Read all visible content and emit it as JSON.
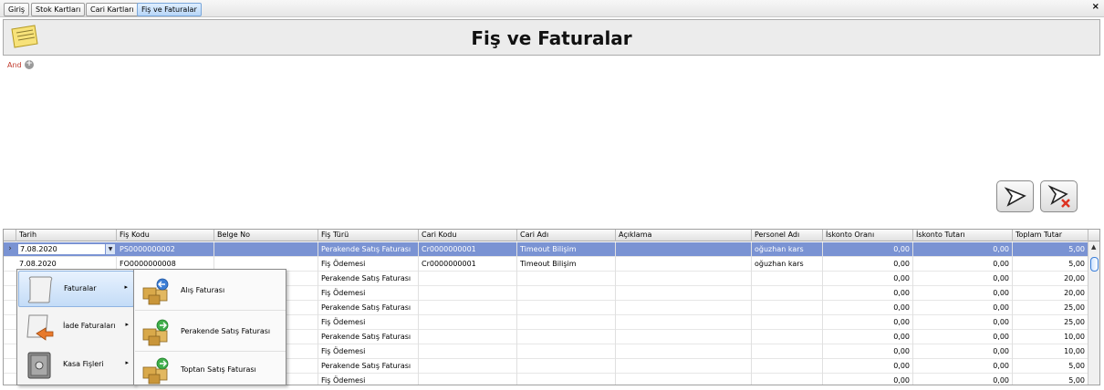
{
  "tabs": [
    {
      "label": "Giriş",
      "active": false
    },
    {
      "label": "Stok Kartları",
      "active": false
    },
    {
      "label": "Cari Kartları",
      "active": false
    },
    {
      "label": "Fiş ve Faturalar",
      "active": true
    }
  ],
  "close_icon": "×",
  "header": {
    "title": "Fiş ve Faturalar",
    "icon": "notepad-icon"
  },
  "filter": {
    "and_label": "And",
    "add_icon": "+",
    "apply_icon": "filter-apply-icon",
    "clear_icon": "filter-clear-icon"
  },
  "grid": {
    "columns": [
      "Tarih",
      "Fiş Kodu",
      "Belge No",
      "Fiş Türü",
      "Cari Kodu",
      "Cari Adı",
      "Açıklama",
      "Personel Adı",
      "İskonto Oranı",
      "İskonto Tutarı",
      "Toplam Tutar"
    ],
    "rows": [
      {
        "tarih": "7.08.2020",
        "fis_kodu": "PS0000000002",
        "belge_no": "",
        "fis_turu": "Perakende Satış Faturası",
        "cari_kodu": "Cr0000000001",
        "cari_adi": "Timeout Bilişim",
        "aciklama": "",
        "personel": "oğuzhan kars",
        "isk_oran": "0,00",
        "isk_tutar": "0,00",
        "toplam": "5,00"
      },
      {
        "tarih": "7.08.2020",
        "fis_kodu": "FO0000000008",
        "belge_no": "",
        "fis_turu": "Fiş Ödemesi",
        "cari_kodu": "Cr0000000001",
        "cari_adi": "Timeout Bilişim",
        "aciklama": "",
        "personel": "oğuzhan kars",
        "isk_oran": "0,00",
        "isk_tutar": "0,00",
        "toplam": "5,00"
      },
      {
        "tarih": "",
        "fis_kodu": "",
        "belge_no": "",
        "fis_turu": "Perakende Satış Faturası",
        "cari_kodu": "",
        "cari_adi": "",
        "aciklama": "",
        "personel": "",
        "isk_oran": "0,00",
        "isk_tutar": "0,00",
        "toplam": "20,00"
      },
      {
        "tarih": "",
        "fis_kodu": "",
        "belge_no": "",
        "fis_turu": "Fiş Ödemesi",
        "cari_kodu": "",
        "cari_adi": "",
        "aciklama": "",
        "personel": "",
        "isk_oran": "0,00",
        "isk_tutar": "0,00",
        "toplam": "20,00"
      },
      {
        "tarih": "",
        "fis_kodu": "",
        "belge_no": "",
        "fis_turu": "Perakende Satış Faturası",
        "cari_kodu": "",
        "cari_adi": "",
        "aciklama": "",
        "personel": "",
        "isk_oran": "0,00",
        "isk_tutar": "0,00",
        "toplam": "25,00"
      },
      {
        "tarih": "",
        "fis_kodu": "",
        "belge_no": "",
        "fis_turu": "Fiş Ödemesi",
        "cari_kodu": "",
        "cari_adi": "",
        "aciklama": "",
        "personel": "",
        "isk_oran": "0,00",
        "isk_tutar": "0,00",
        "toplam": "25,00"
      },
      {
        "tarih": "",
        "fis_kodu": "",
        "belge_no": "",
        "fis_turu": "Perakende Satış Faturası",
        "cari_kodu": "",
        "cari_adi": "",
        "aciklama": "",
        "personel": "",
        "isk_oran": "0,00",
        "isk_tutar": "0,00",
        "toplam": "10,00"
      },
      {
        "tarih": "",
        "fis_kodu": "",
        "belge_no": "",
        "fis_turu": "Fiş Ödemesi",
        "cari_kodu": "",
        "cari_adi": "",
        "aciklama": "",
        "personel": "",
        "isk_oran": "0,00",
        "isk_tutar": "0,00",
        "toplam": "10,00"
      },
      {
        "tarih": "",
        "fis_kodu": "",
        "belge_no": "",
        "fis_turu": "Perakende Satış Faturası",
        "cari_kodu": "",
        "cari_adi": "",
        "aciklama": "",
        "personel": "",
        "isk_oran": "0,00",
        "isk_tutar": "0,00",
        "toplam": "5,00"
      },
      {
        "tarih": "",
        "fis_kodu": "",
        "belge_no": "",
        "fis_turu": "Fiş Ödemesi",
        "cari_kodu": "",
        "cari_adi": "",
        "aciklama": "",
        "personel": "",
        "isk_oran": "0,00",
        "isk_tutar": "0,00",
        "toplam": "5,00"
      }
    ],
    "row_indicator": "›",
    "dropdown_icon": "▼"
  },
  "context_menu": {
    "items": [
      {
        "label": "Faturalar",
        "icon": "scroll-icon",
        "arrow": "▸"
      },
      {
        "label": "İade Faturaları",
        "icon": "return-scroll-icon",
        "arrow": "▸"
      },
      {
        "label": "Kasa Fişleri",
        "icon": "safe-icon",
        "arrow": "▸"
      }
    ]
  },
  "submenu": {
    "items": [
      {
        "label": "Alış Faturası",
        "icon": "boxes-buy-icon"
      },
      {
        "label": "Perakende Satış Faturası",
        "icon": "boxes-retail-icon"
      },
      {
        "label": "Toptan Satış Faturası",
        "icon": "boxes-wholesale-icon"
      }
    ]
  },
  "colors": {
    "selection": "#7a93d3",
    "menu_highlight": "#c4dcf7",
    "accent_and": "#c0392b"
  }
}
